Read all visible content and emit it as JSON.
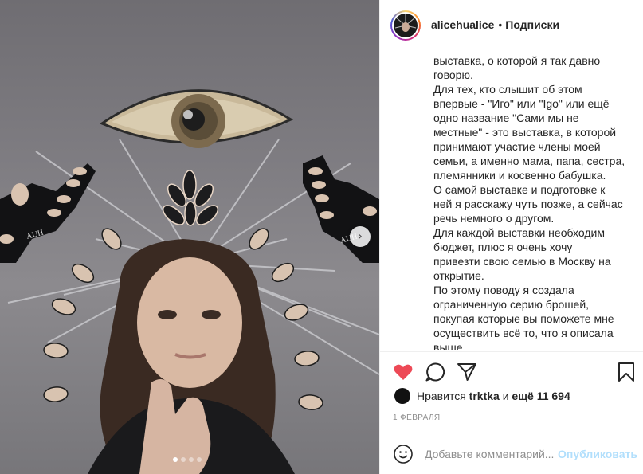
{
  "post": {
    "username": "alicehualice",
    "separator": "•",
    "follow_label": "Подписки",
    "caption_lines": [
      "выставка, о которой я так давно",
      "говорю.",
      "Для тех, кто слышит об этом",
      "впервые - \"Иго\" или \"Igo\" или ещё",
      "одно название \"Сами мы не",
      "местные\" - это выставка, в которой",
      "принимают участие члены моей",
      "семьи, а именно мама, папа, сестра,",
      "племянники и косвенно бабушка.",
      "О самой выставке и подготовке к",
      "ней я расскажу чуть позже, а сейчас",
      "речь немного о другом.",
      "Для каждой выставки необходим",
      "бюджет, плюс я очень хочу",
      "привезти свою семью в Москву на",
      "открытие.",
      "По этому поводу я создала",
      "ограниченную серию брошей,",
      "покупая которые вы поможете мне",
      "осуществить всё то, что я описала",
      "выше."
    ],
    "likes_prefix": "Нравится",
    "likes_user": "trktka",
    "likes_middle": "и",
    "likes_count": "ещё 11 694",
    "date": "1 ФЕВРАЛЯ",
    "comment_placeholder": "Добавьте комментарий...",
    "publish_label": "Опубликовать",
    "photo_label_left": "AUH",
    "photo_label_right": "AUH",
    "carousel": {
      "total": 4,
      "active_index": 0
    }
  },
  "colors": {
    "like_red": "#ed4956",
    "text": "#262626",
    "muted": "#8e8e8e",
    "publish_disabled": "#b2dffc",
    "border": "#efefef"
  },
  "icons": {
    "like": "heart-icon",
    "comment": "comment-icon",
    "share": "paper-plane-icon",
    "save": "bookmark-icon",
    "emoji": "smiley-icon",
    "next": "chevron-right-icon"
  }
}
